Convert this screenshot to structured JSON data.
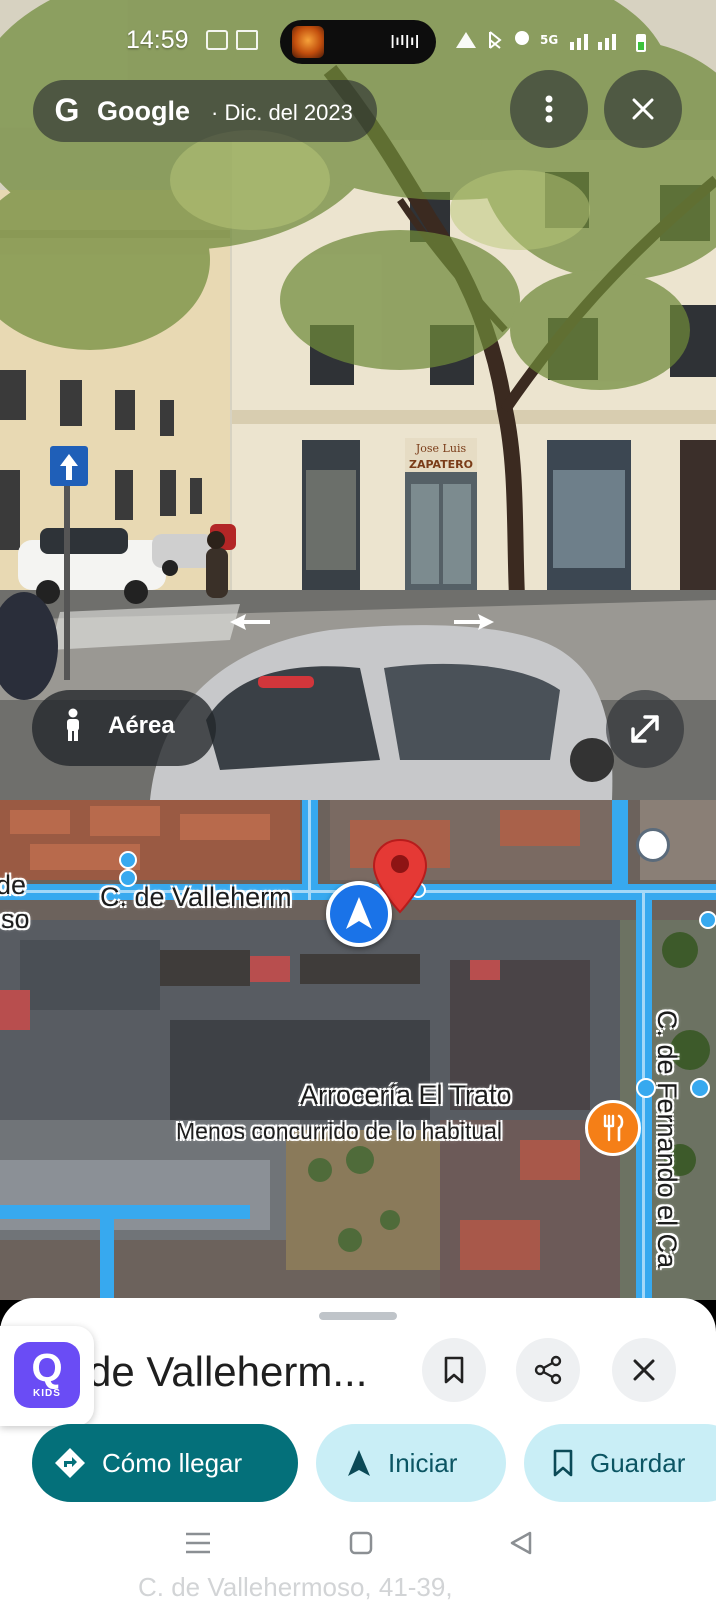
{
  "status_bar": {
    "time": "14:59",
    "icons": [
      "calendar-icon",
      "gmail-icon",
      "mute-icon",
      "bluetooth-icon",
      "location-icon",
      "5g-icon",
      "signal-icon",
      "battery-icon"
    ],
    "network": "5G"
  },
  "street_view": {
    "brand": "Google",
    "date": "· Dic. del 2023",
    "shop_sign_line1": "Jose Luis",
    "shop_sign_line2": "ZAPATERO",
    "aerial_label": "Aérea",
    "icons": [
      "more-vert-icon",
      "close-icon",
      "person-icon",
      "expand-icon",
      "arrow-left-icon",
      "arrow-right-icon"
    ]
  },
  "map": {
    "street_label": "C. de Valleherm",
    "street_left_fragment_1": "de",
    "street_left_fragment_2": "oso",
    "vertical_street_label": "C. de Fernando el Ca",
    "poi_name": "Arrocería El Trato",
    "poi_status": "Menos concurrido de lo habitual"
  },
  "sheet": {
    "title": "de Valleherm...",
    "kids_label": "KIDS",
    "actions": {
      "directions": "Cómo llegar",
      "start": "Iniciar",
      "save": "Guardar"
    }
  },
  "bottom_hint": "C. de Vallehermoso, 41-39,",
  "colors": {
    "primary_teal": "#04707a",
    "secondary_chip": "#c9eef6",
    "road_blue": "#37a9ef",
    "pin_red": "#e53935",
    "poi_orange": "#f57f17",
    "nav_blue": "#1a73e8",
    "kids_purple": "#6a4cf5"
  }
}
